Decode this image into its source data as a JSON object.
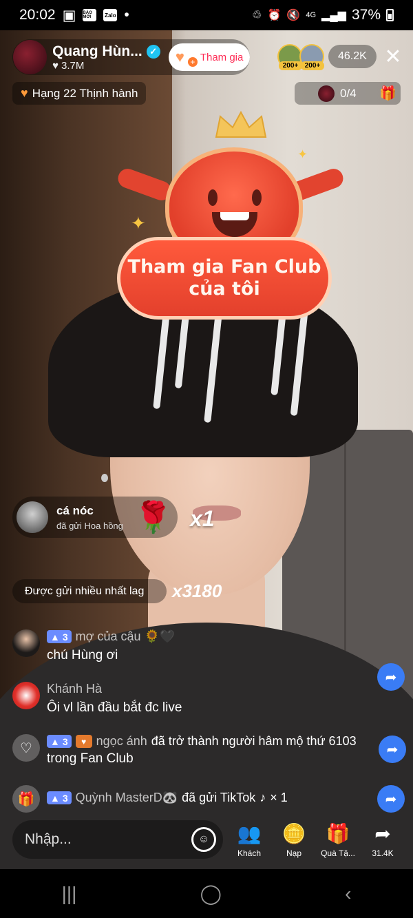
{
  "status_bar": {
    "time": "20:02",
    "mini_icons": [
      "BÁO MỚI",
      "Zalo"
    ],
    "dot": "•",
    "battery": "37%"
  },
  "host": {
    "name": "Quang Hùn...",
    "likes": "3.7M",
    "join_label": "Tham gia"
  },
  "viewers": {
    "tags": [
      "200+",
      "200+"
    ],
    "count": "46.2K"
  },
  "rank": {
    "label": "Hạng 22 Thịnh hành"
  },
  "goal": {
    "progress": "0/4"
  },
  "sticker": {
    "line1": "Tham gia Fan Club",
    "line2": "của tôi"
  },
  "gift_notice": {
    "user": "cá nóc",
    "desc": "đã gửi Hoa hồng",
    "multiplier": "x1"
  },
  "most_sent": {
    "label": "Được gửi nhiều nhất lag",
    "multiplier": "x3180"
  },
  "chat": [
    {
      "type": "user",
      "level": "3",
      "name": "mợ của cậu 🌻🖤",
      "message": "chú Hùng ơi"
    },
    {
      "type": "user",
      "name": "Khánh Hà",
      "message": "Ôi vl lần đầu bắt đc live"
    },
    {
      "type": "system",
      "level": "3",
      "name": "ngọc ánh",
      "action": "đã trở thành người hâm mộ thứ 6103",
      "message": "trong Fan Club"
    },
    {
      "type": "gift",
      "level": "3",
      "name": "Quỳnh MasterD🐼",
      "action": "đã gửi TikTok",
      "count": "× 1"
    }
  ],
  "input": {
    "placeholder": "Nhập..."
  },
  "actions": [
    {
      "label": "Khách"
    },
    {
      "label": "Nạp"
    },
    {
      "label": "Quà Tặ..."
    },
    {
      "label": "31.4K"
    }
  ],
  "colors": {
    "accent": "#fe2c55",
    "level_badge": "#6b8cff",
    "share": "#3a7cf5",
    "sticker_red": "#e2402b"
  }
}
